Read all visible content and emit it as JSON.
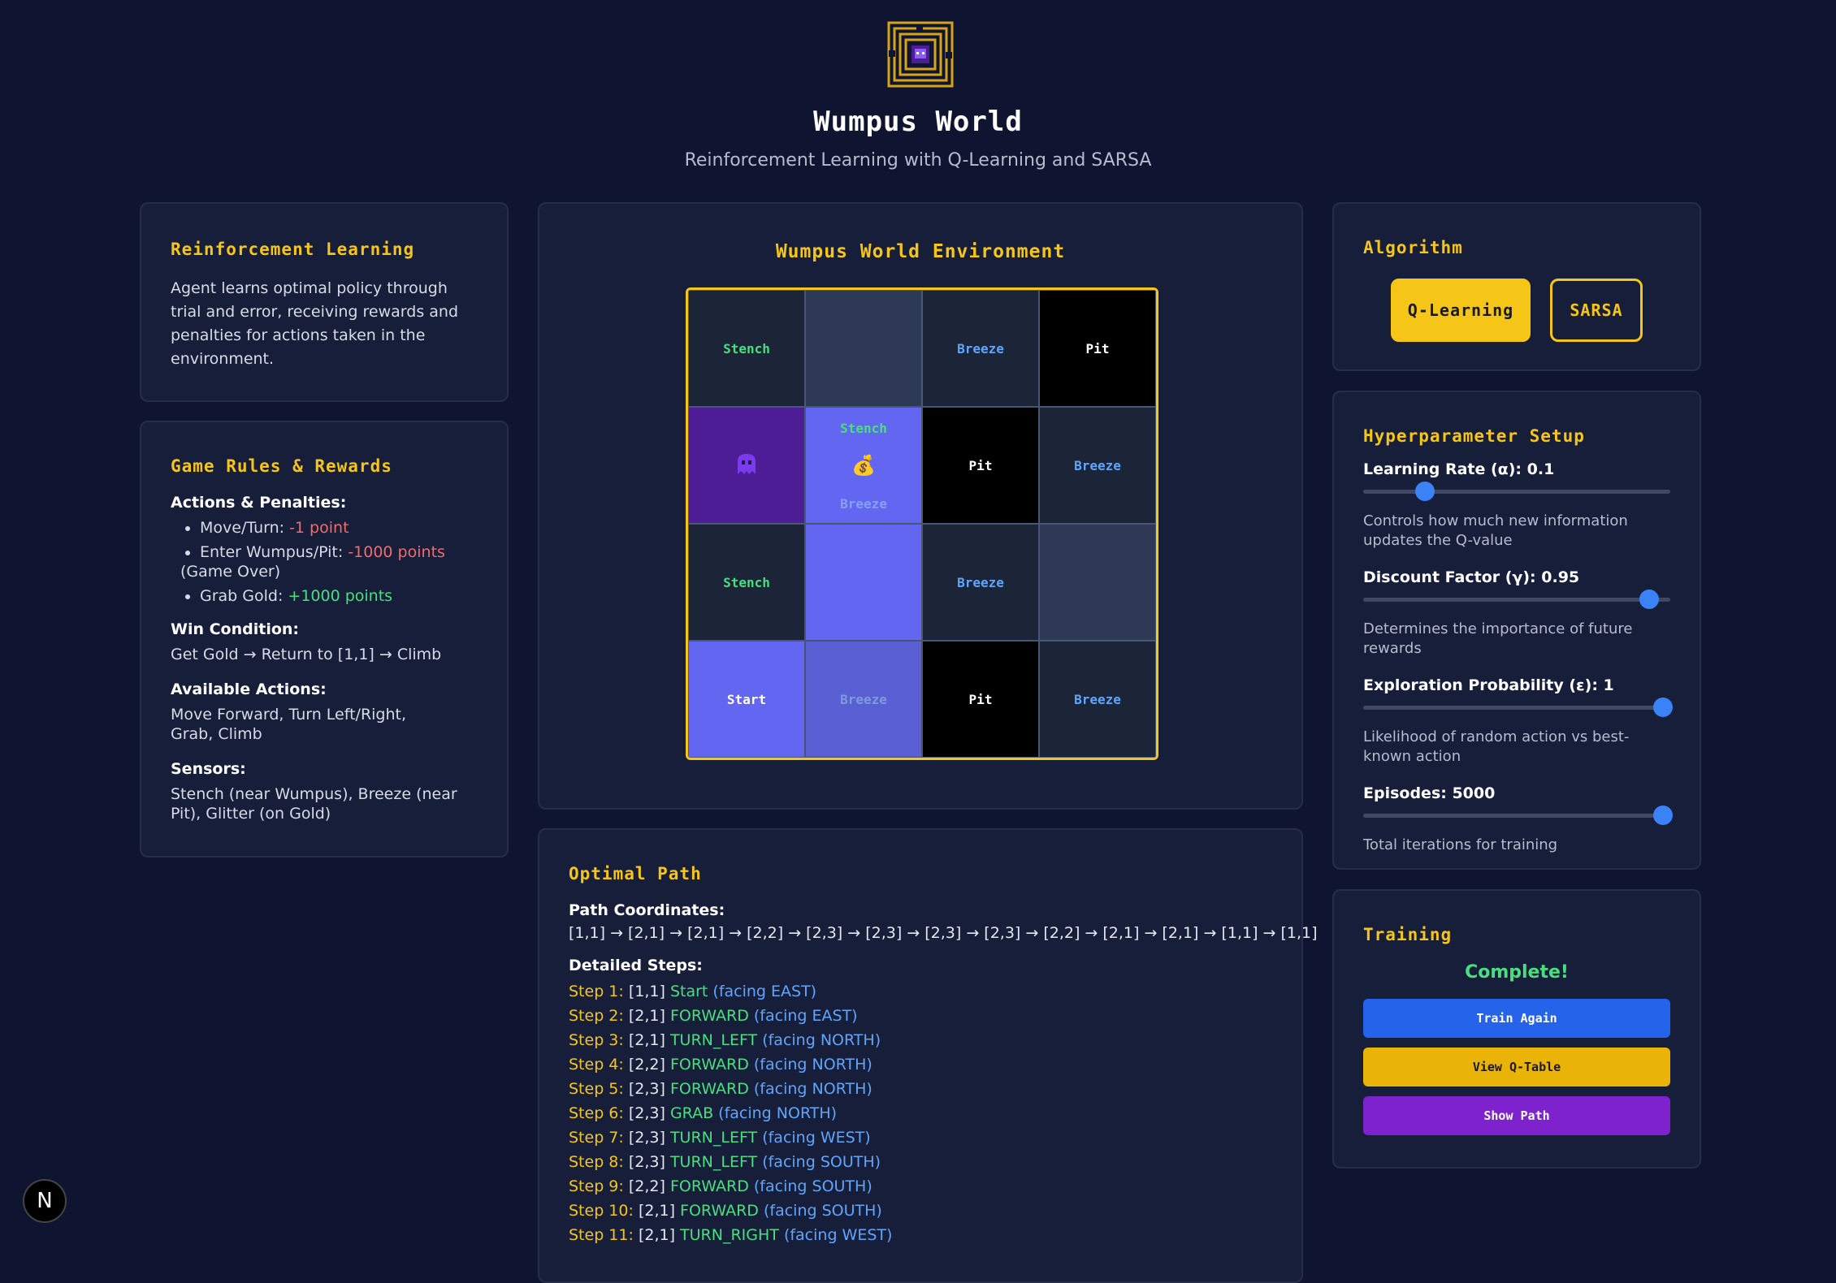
{
  "header": {
    "title": "Wumpus World",
    "subtitle": "Reinforcement Learning with Q-Learning and SARSA"
  },
  "rl_card": {
    "title": "Reinforcement Learning",
    "text": "Agent learns optimal policy through trial and error, receiving rewards and penalties for actions taken in the environment."
  },
  "rules": {
    "title": "Game Rules & Rewards",
    "actions_heading": "Actions & Penalties:",
    "items": [
      {
        "label": "Move/Turn: ",
        "value": "-1 point",
        "extra": ""
      },
      {
        "label": "Enter Wumpus/Pit: ",
        "value": "-1000 points",
        "extra": "(Game Over)"
      },
      {
        "label": "Grab Gold: ",
        "value": "+1000 points",
        "extra": ""
      }
    ],
    "win_heading": "Win Condition:",
    "win_text": "Get Gold → Return to [1,1] → Climb",
    "available_heading": "Available Actions:",
    "available_text": "Move Forward, Turn Left/Right, Grab, Climb",
    "sensors_heading": "Sensors:",
    "sensors_text": "Stench (near Wumpus), Breeze (near Pit), Glitter (on Gold)"
  },
  "environment": {
    "title": "Wumpus World Environment",
    "cells": {
      "r1c1": "Stench",
      "r1c3": "Breeze",
      "r1c4": "Pit",
      "r2c2_top": "Stench",
      "r2c2_icon": "💰",
      "r2c2_bottom": "Breeze",
      "r2c3": "Pit",
      "r2c4": "Breeze",
      "r3c1": "Stench",
      "r3c3": "Breeze",
      "r4c1": "Start",
      "r4c2": "Breeze",
      "r4c3": "Pit",
      "r4c4": "Breeze"
    }
  },
  "path": {
    "title": "Optimal Path",
    "coords_heading": "Path Coordinates:",
    "coords": "[1,1] → [2,1] → [2,1] → [2,2] → [2,3] → [2,3] → [2,3] → [2,3] → [2,2] → [2,1] → [2,1] → [1,1] → [1,1]",
    "steps_heading": "Detailed Steps:",
    "steps": [
      {
        "num": "Step 1:",
        "pos": "[1,1]",
        "action": "Start",
        "dir": "(facing EAST)"
      },
      {
        "num": "Step 2:",
        "pos": "[2,1]",
        "action": "FORWARD",
        "dir": "(facing EAST)"
      },
      {
        "num": "Step 3:",
        "pos": "[2,1]",
        "action": "TURN_LEFT",
        "dir": "(facing NORTH)"
      },
      {
        "num": "Step 4:",
        "pos": "[2,2]",
        "action": "FORWARD",
        "dir": "(facing NORTH)"
      },
      {
        "num": "Step 5:",
        "pos": "[2,3]",
        "action": "FORWARD",
        "dir": "(facing NORTH)"
      },
      {
        "num": "Step 6:",
        "pos": "[2,3]",
        "action": "GRAB",
        "dir": "(facing NORTH)"
      },
      {
        "num": "Step 7:",
        "pos": "[2,3]",
        "action": "TURN_LEFT",
        "dir": "(facing WEST)"
      },
      {
        "num": "Step 8:",
        "pos": "[2,3]",
        "action": "TURN_LEFT",
        "dir": "(facing SOUTH)"
      },
      {
        "num": "Step 9:",
        "pos": "[2,2]",
        "action": "FORWARD",
        "dir": "(facing SOUTH)"
      },
      {
        "num": "Step 10:",
        "pos": "[2,1]",
        "action": "FORWARD",
        "dir": "(facing SOUTH)"
      },
      {
        "num": "Step 11:",
        "pos": "[2,1]",
        "action": "TURN_RIGHT",
        "dir": "(facing WEST)"
      }
    ]
  },
  "algorithm": {
    "title": "Algorithm",
    "options": [
      "Q-Learning",
      "SARSA"
    ],
    "selected": "Q-Learning"
  },
  "hyper": {
    "title": "Hyperparameter Setup",
    "params": [
      {
        "label": "Learning Rate (α): 0.1",
        "fraction": 0.1,
        "desc": "Controls how much new information updates the Q-value"
      },
      {
        "label": "Discount Factor (γ): 0.95",
        "fraction": 0.95,
        "desc": "Determines the importance of future rewards"
      },
      {
        "label": "Exploration Probability (ε): 1",
        "fraction": 1.0,
        "desc": "Likelihood of random action vs best-known action"
      },
      {
        "label": "Episodes: 5000",
        "fraction": 1.0,
        "desc": "Total iterations for training"
      }
    ]
  },
  "training": {
    "title": "Training",
    "status": "Complete!",
    "train_again": "Train Again",
    "view_qtable": "View Q-Table",
    "show_path": "Show Path"
  },
  "badge": "N",
  "colors": {
    "background": "#0f1530",
    "card": "#171e3a",
    "accent": "#f5c518",
    "stench": "#4ade80",
    "breeze": "#60a5fa",
    "agent_cell": "#6366f1"
  }
}
